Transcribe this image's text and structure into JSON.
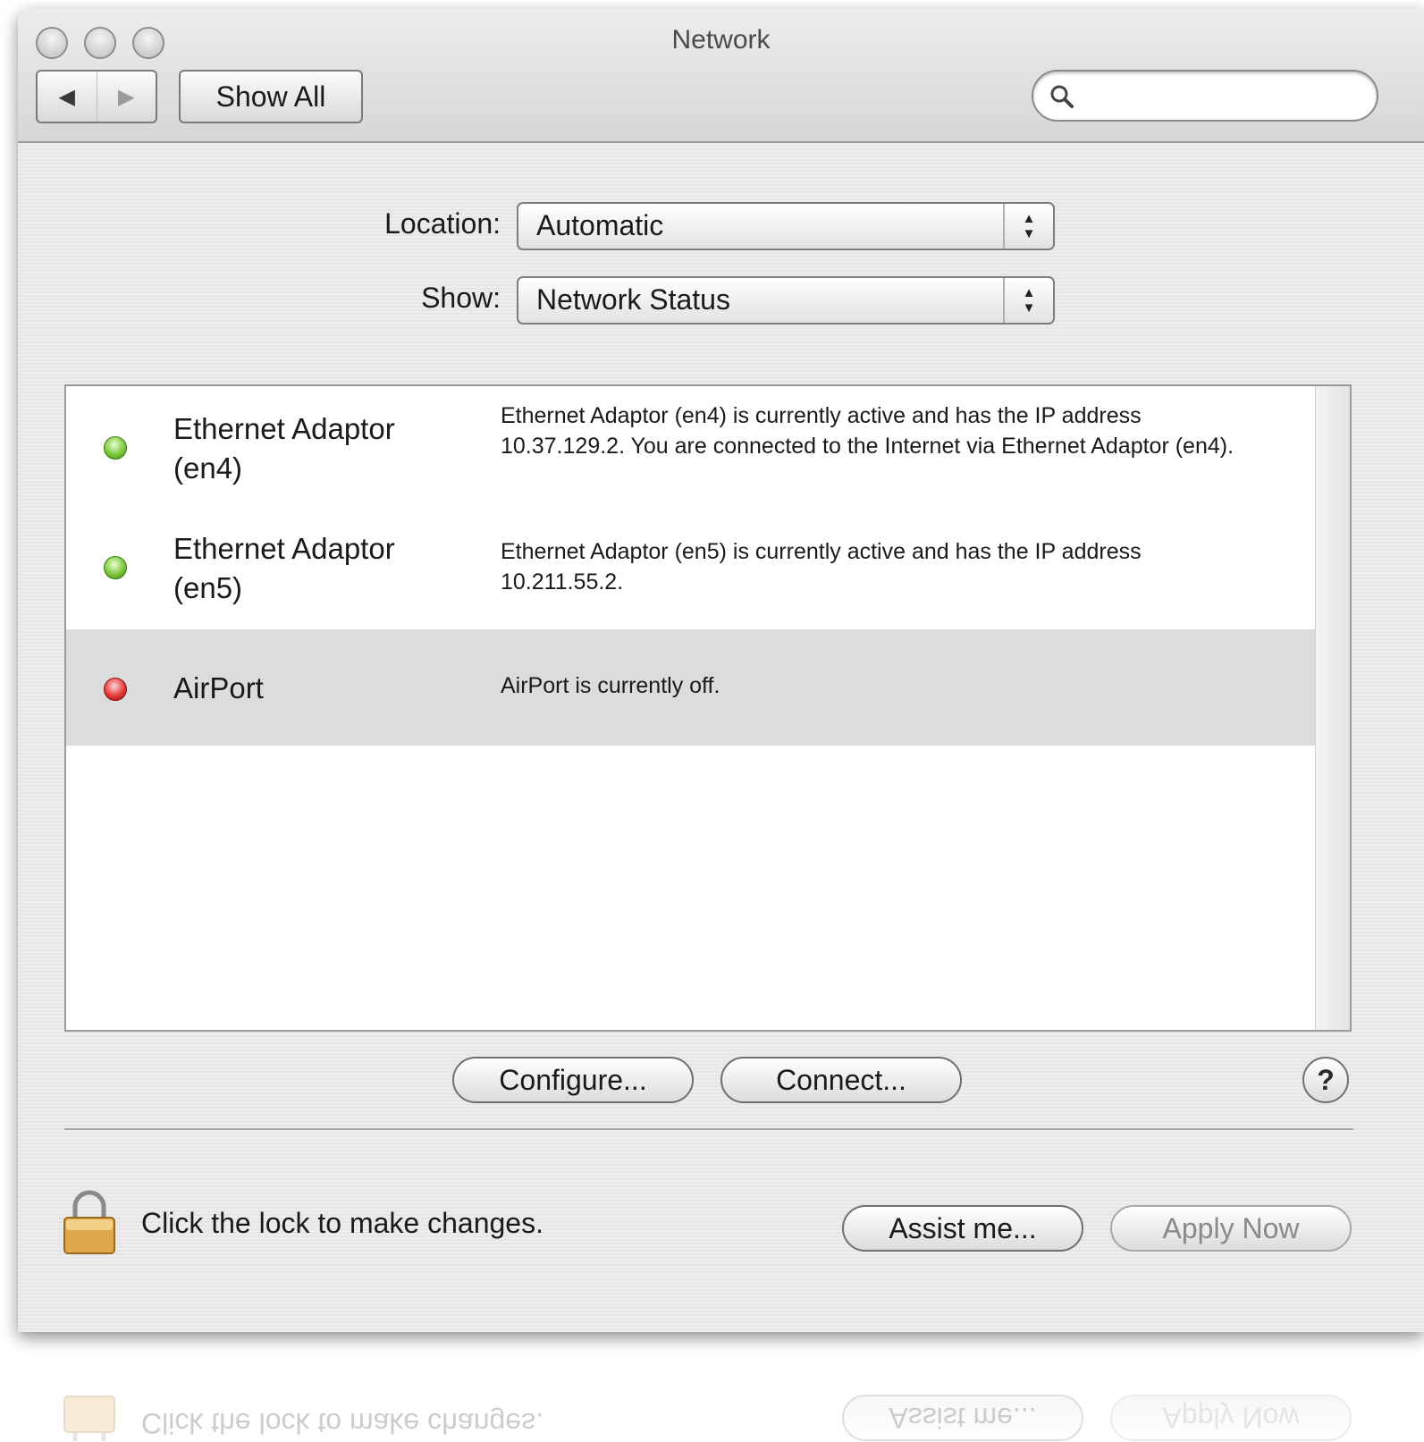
{
  "window": {
    "title": "Network"
  },
  "toolbar": {
    "back_glyph": "◀",
    "forward_glyph": "▶",
    "show_all_label": "Show All",
    "search_placeholder": ""
  },
  "location": {
    "label": "Location:",
    "value": "Automatic"
  },
  "show": {
    "label": "Show:",
    "value": "Network Status"
  },
  "services": [
    {
      "name": "Ethernet Adaptor (en4)",
      "status": "green",
      "description": "Ethernet Adaptor (en4) is currently active and has the IP address 10.37.129.2. You are connected to the Internet via Ethernet Adaptor (en4)."
    },
    {
      "name": "Ethernet Adaptor (en5)",
      "status": "green",
      "description": "Ethernet Adaptor (en5) is currently active and has the IP address 10.211.55.2."
    },
    {
      "name": "AirPort",
      "status": "red",
      "description": "AirPort is currently off."
    }
  ],
  "actions": {
    "configure_label": "Configure...",
    "connect_label": "Connect...",
    "help_label": "?"
  },
  "footer": {
    "lock_text": "Click the lock to make changes.",
    "assist_label": "Assist me...",
    "apply_label": "Apply Now"
  },
  "colors": {
    "status_green": "#7dc63e",
    "status_red": "#e23a3a",
    "selected_row": "#dcdcdc"
  },
  "icons": {
    "back": "back-arrow-icon",
    "forward": "forward-arrow-icon",
    "search": "search-icon",
    "lock": "lock-icon",
    "help": "help-icon"
  }
}
